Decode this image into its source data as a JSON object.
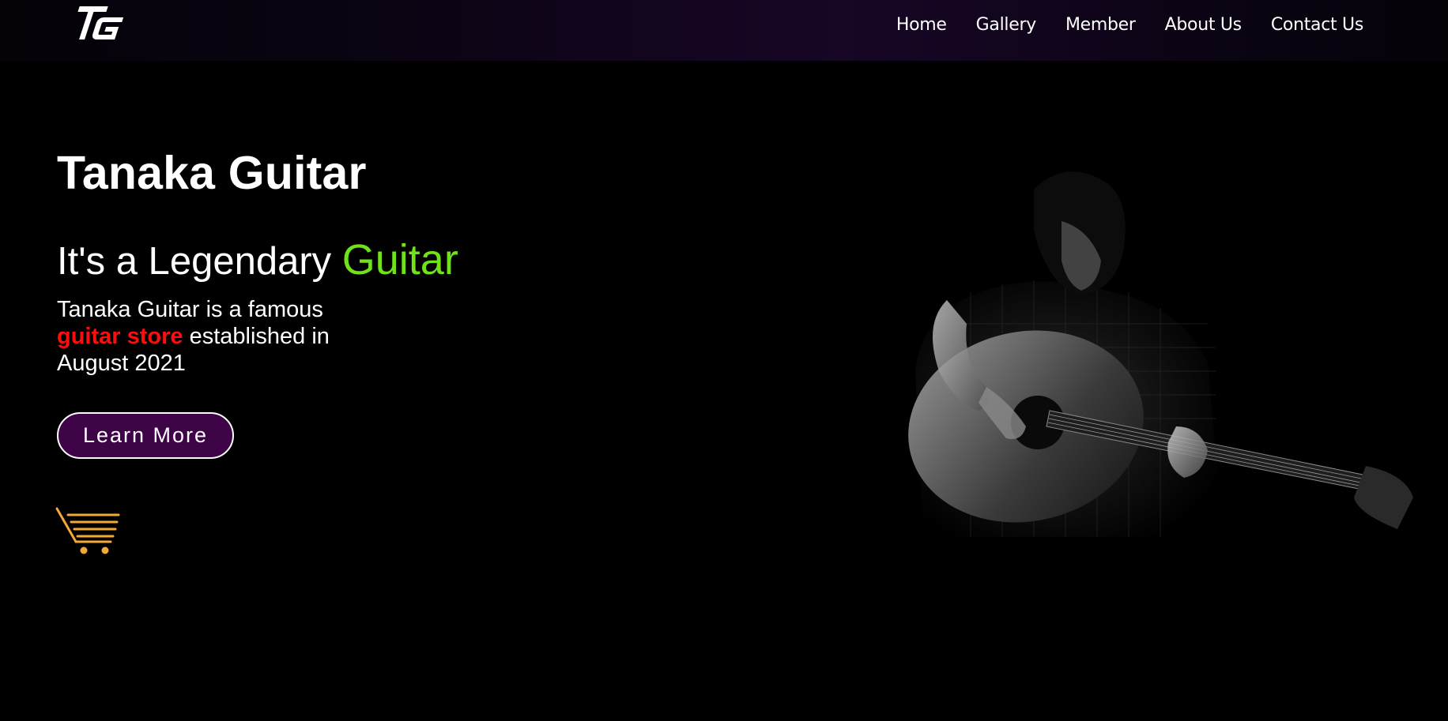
{
  "header": {
    "logo_icon": "tg-logo",
    "nav": [
      {
        "label": "Home"
      },
      {
        "label": "Gallery"
      },
      {
        "label": "Member"
      },
      {
        "label": "About Us"
      },
      {
        "label": "Contact Us"
      }
    ]
  },
  "hero": {
    "title": "Tanaka Guitar",
    "subtitle_prefix": "It's a Legendary ",
    "subtitle_accent": "Guitar",
    "desc_part1": "Tanaka Guitar is a famous ",
    "desc_accent": "guitar store",
    "desc_part2": " established in August 2021",
    "button_label": "Learn More",
    "cart_icon": "shopping-cart-icon",
    "image": "guitarist-photo"
  },
  "colors": {
    "background": "#000000",
    "header_purple": "#170626",
    "accent_green": "#6fe21a",
    "accent_red": "#ff0d0d",
    "button_fill": "#3f0348",
    "cart_orange": "#f5a73a"
  }
}
